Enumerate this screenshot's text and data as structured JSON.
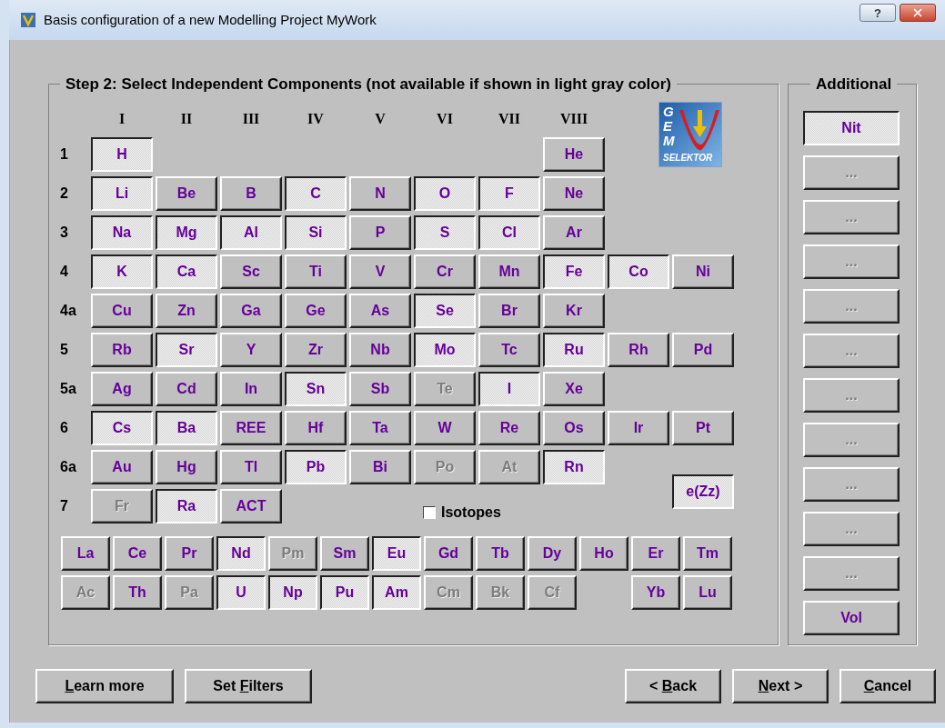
{
  "window": {
    "title": "Basis configuration of a new Modelling Project  MyWork",
    "help": "?"
  },
  "step_group": {
    "title": "Step 2: Select Independent Components (not available if shown in light gray color)",
    "groups": [
      "I",
      "II",
      "III",
      "IV",
      "V",
      "VI",
      "VII",
      "VIII"
    ],
    "logo": {
      "vertical": "GEM",
      "bottom": "SELEKTOR"
    },
    "rows": [
      {
        "label": "1",
        "cells": [
          {
            "symbol": "H",
            "selected": true,
            "disabled": false
          },
          {
            "kind": "gap"
          },
          {
            "kind": "gap"
          },
          {
            "kind": "gap"
          },
          {
            "kind": "gap"
          },
          {
            "kind": "gap"
          },
          {
            "kind": "gap"
          },
          {
            "symbol": "He",
            "selected": false,
            "disabled": false
          }
        ]
      },
      {
        "label": "2",
        "cells": [
          {
            "symbol": "Li",
            "selected": true,
            "disabled": false
          },
          {
            "symbol": "Be",
            "selected": false,
            "disabled": false
          },
          {
            "symbol": "B",
            "selected": false,
            "disabled": false
          },
          {
            "symbol": "C",
            "selected": true,
            "disabled": false
          },
          {
            "symbol": "N",
            "selected": false,
            "disabled": false
          },
          {
            "symbol": "O",
            "selected": true,
            "disabled": false
          },
          {
            "symbol": "F",
            "selected": true,
            "disabled": false
          },
          {
            "symbol": "Ne",
            "selected": false,
            "disabled": false
          }
        ]
      },
      {
        "label": "3",
        "cells": [
          {
            "symbol": "Na",
            "selected": true,
            "disabled": false
          },
          {
            "symbol": "Mg",
            "selected": true,
            "disabled": false
          },
          {
            "symbol": "Al",
            "selected": true,
            "disabled": false
          },
          {
            "symbol": "Si",
            "selected": true,
            "disabled": false
          },
          {
            "symbol": "P",
            "selected": false,
            "disabled": false
          },
          {
            "symbol": "S",
            "selected": true,
            "disabled": false
          },
          {
            "symbol": "Cl",
            "selected": true,
            "disabled": false
          },
          {
            "symbol": "Ar",
            "selected": false,
            "disabled": false
          }
        ]
      },
      {
        "label": "4",
        "cells": [
          {
            "symbol": "K",
            "selected": true,
            "disabled": false
          },
          {
            "symbol": "Ca",
            "selected": true,
            "disabled": false
          },
          {
            "symbol": "Sc",
            "selected": false,
            "disabled": false
          },
          {
            "symbol": "Ti",
            "selected": false,
            "disabled": false
          },
          {
            "symbol": "V",
            "selected": false,
            "disabled": false
          },
          {
            "symbol": "Cr",
            "selected": false,
            "disabled": false
          },
          {
            "symbol": "Mn",
            "selected": false,
            "disabled": false
          },
          {
            "symbol": "Fe",
            "selected": true,
            "disabled": false
          },
          {
            "symbol": "Co",
            "selected": true,
            "disabled": false
          },
          {
            "symbol": "Ni",
            "selected": false,
            "disabled": false
          }
        ]
      },
      {
        "label": "4a",
        "cells": [
          {
            "symbol": "Cu",
            "selected": false,
            "disabled": false
          },
          {
            "symbol": "Zn",
            "selected": false,
            "disabled": false
          },
          {
            "symbol": "Ga",
            "selected": false,
            "disabled": false
          },
          {
            "symbol": "Ge",
            "selected": false,
            "disabled": false
          },
          {
            "symbol": "As",
            "selected": false,
            "disabled": false
          },
          {
            "symbol": "Se",
            "selected": true,
            "disabled": false
          },
          {
            "symbol": "Br",
            "selected": false,
            "disabled": false
          },
          {
            "symbol": "Kr",
            "selected": false,
            "disabled": false
          }
        ]
      },
      {
        "label": "5",
        "cells": [
          {
            "symbol": "Rb",
            "selected": false,
            "disabled": false
          },
          {
            "symbol": "Sr",
            "selected": true,
            "disabled": false
          },
          {
            "symbol": "Y",
            "selected": false,
            "disabled": false
          },
          {
            "symbol": "Zr",
            "selected": false,
            "disabled": false
          },
          {
            "symbol": "Nb",
            "selected": false,
            "disabled": false
          },
          {
            "symbol": "Mo",
            "selected": true,
            "disabled": false
          },
          {
            "symbol": "Tc",
            "selected": false,
            "disabled": false
          },
          {
            "symbol": "Ru",
            "selected": true,
            "disabled": false
          },
          {
            "symbol": "Rh",
            "selected": false,
            "disabled": false
          },
          {
            "symbol": "Pd",
            "selected": false,
            "disabled": false
          }
        ]
      },
      {
        "label": "5a",
        "cells": [
          {
            "symbol": "Ag",
            "selected": false,
            "disabled": false
          },
          {
            "symbol": "Cd",
            "selected": false,
            "disabled": false
          },
          {
            "symbol": "In",
            "selected": false,
            "disabled": false
          },
          {
            "symbol": "Sn",
            "selected": true,
            "disabled": false
          },
          {
            "symbol": "Sb",
            "selected": false,
            "disabled": false
          },
          {
            "symbol": "Te",
            "selected": false,
            "disabled": true
          },
          {
            "symbol": "I",
            "selected": true,
            "disabled": false
          },
          {
            "symbol": "Xe",
            "selected": false,
            "disabled": false
          }
        ]
      },
      {
        "label": "6",
        "cells": [
          {
            "symbol": "Cs",
            "selected": true,
            "disabled": false
          },
          {
            "symbol": "Ba",
            "selected": true,
            "disabled": false
          },
          {
            "symbol": "REE",
            "selected": false,
            "disabled": false
          },
          {
            "symbol": "Hf",
            "selected": false,
            "disabled": false
          },
          {
            "symbol": "Ta",
            "selected": false,
            "disabled": false
          },
          {
            "symbol": "W",
            "selected": false,
            "disabled": false
          },
          {
            "symbol": "Re",
            "selected": false,
            "disabled": false
          },
          {
            "symbol": "Os",
            "selected": false,
            "disabled": false
          },
          {
            "symbol": "Ir",
            "selected": false,
            "disabled": false
          },
          {
            "symbol": "Pt",
            "selected": false,
            "disabled": false
          }
        ]
      },
      {
        "label": "6a",
        "cells": [
          {
            "symbol": "Au",
            "selected": false,
            "disabled": false
          },
          {
            "symbol": "Hg",
            "selected": false,
            "disabled": false
          },
          {
            "symbol": "Tl",
            "selected": false,
            "disabled": false
          },
          {
            "symbol": "Pb",
            "selected": true,
            "disabled": false
          },
          {
            "symbol": "Bi",
            "selected": false,
            "disabled": false
          },
          {
            "symbol": "Po",
            "selected": false,
            "disabled": true
          },
          {
            "symbol": "At",
            "selected": false,
            "disabled": true
          },
          {
            "symbol": "Rn",
            "selected": true,
            "disabled": false
          }
        ]
      },
      {
        "label": "7",
        "cells": [
          {
            "symbol": "Fr",
            "selected": false,
            "disabled": true
          },
          {
            "symbol": "Ra",
            "selected": true,
            "disabled": false
          },
          {
            "symbol": "ACT",
            "selected": false,
            "disabled": false
          }
        ]
      }
    ],
    "isotopes": {
      "label": "Isotopes",
      "checked": false
    },
    "electron": {
      "symbol": "e(Zz)",
      "selected": true,
      "disabled": false
    },
    "series": [
      [
        {
          "symbol": "La",
          "selected": false,
          "disabled": false
        },
        {
          "symbol": "Ce",
          "selected": false,
          "disabled": false
        },
        {
          "symbol": "Pr",
          "selected": false,
          "disabled": false
        },
        {
          "symbol": "Nd",
          "selected": true,
          "disabled": false
        },
        {
          "symbol": "Pm",
          "selected": false,
          "disabled": true
        },
        {
          "symbol": "Sm",
          "selected": false,
          "disabled": false
        },
        {
          "symbol": "Eu",
          "selected": true,
          "disabled": false
        },
        {
          "symbol": "Gd",
          "selected": false,
          "disabled": false
        },
        {
          "symbol": "Tb",
          "selected": false,
          "disabled": false
        },
        {
          "symbol": "Dy",
          "selected": false,
          "disabled": false
        },
        {
          "symbol": "Ho",
          "selected": false,
          "disabled": false
        },
        {
          "symbol": "Er",
          "selected": false,
          "disabled": false
        },
        {
          "symbol": "Tm",
          "selected": false,
          "disabled": false
        }
      ],
      [
        {
          "symbol": "Ac",
          "selected": false,
          "disabled": true
        },
        {
          "symbol": "Th",
          "selected": false,
          "disabled": false
        },
        {
          "symbol": "Pa",
          "selected": false,
          "disabled": true
        },
        {
          "symbol": "U",
          "selected": true,
          "disabled": false
        },
        {
          "symbol": "Np",
          "selected": true,
          "disabled": false
        },
        {
          "symbol": "Pu",
          "selected": true,
          "disabled": false
        },
        {
          "symbol": "Am",
          "selected": true,
          "disabled": false
        },
        {
          "symbol": "Cm",
          "selected": false,
          "disabled": true
        },
        {
          "symbol": "Bk",
          "selected": false,
          "disabled": true
        },
        {
          "symbol": "Cf",
          "selected": false,
          "disabled": true
        },
        {
          "kind": "gap"
        },
        {
          "symbol": "Yb",
          "selected": false,
          "disabled": false
        },
        {
          "symbol": "Lu",
          "selected": false,
          "disabled": false
        }
      ]
    ]
  },
  "additional": {
    "title": "Additional",
    "items": [
      {
        "symbol": "Nit",
        "selected": true,
        "disabled": false
      },
      {
        "symbol": "...",
        "selected": false,
        "disabled": true
      },
      {
        "symbol": "...",
        "selected": false,
        "disabled": true
      },
      {
        "symbol": "...",
        "selected": false,
        "disabled": true
      },
      {
        "symbol": "...",
        "selected": false,
        "disabled": true
      },
      {
        "symbol": "...",
        "selected": false,
        "disabled": true
      },
      {
        "symbol": "...",
        "selected": false,
        "disabled": true
      },
      {
        "symbol": "...",
        "selected": false,
        "disabled": true
      },
      {
        "symbol": "...",
        "selected": false,
        "disabled": true
      },
      {
        "symbol": "...",
        "selected": false,
        "disabled": true
      },
      {
        "symbol": "...",
        "selected": false,
        "disabled": true
      },
      {
        "symbol": "Vol",
        "selected": false,
        "disabled": false
      }
    ]
  },
  "buttons_left": [
    {
      "parts": [
        {
          "text": "L",
          "underlined": true
        },
        {
          "text": "earn more",
          "underlined": false
        }
      ]
    },
    {
      "parts": [
        {
          "text": "Set ",
          "underlined": false
        },
        {
          "text": "F",
          "underlined": true
        },
        {
          "text": "ilters",
          "underlined": false
        }
      ]
    }
  ],
  "buttons_right": [
    {
      "parts": [
        {
          "text": "< ",
          "underlined": false
        },
        {
          "text": "B",
          "underlined": true
        },
        {
          "text": "ack",
          "underlined": false
        }
      ]
    },
    {
      "parts": [
        {
          "text": "N",
          "underlined": true
        },
        {
          "text": "ext >",
          "underlined": false
        }
      ]
    },
    {
      "parts": [
        {
          "text": "C",
          "underlined": true
        },
        {
          "text": "ancel",
          "underlined": false
        }
      ]
    }
  ]
}
